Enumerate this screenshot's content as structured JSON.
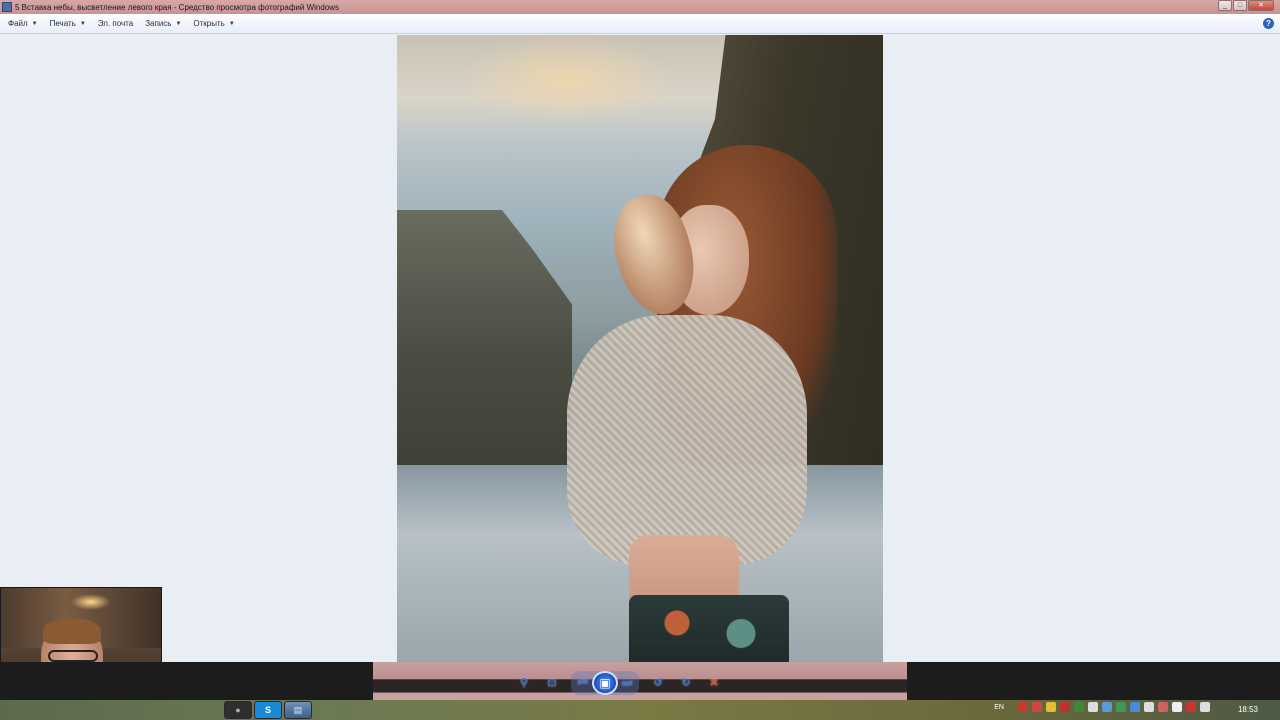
{
  "window": {
    "title": "5 Вставка небы, высветление левого края - Средство просмотра фотографий Windows",
    "controls": [
      "minimize",
      "maximize",
      "close"
    ]
  },
  "menu": {
    "items": [
      {
        "label": "Файл",
        "has_dropdown": true
      },
      {
        "label": "Печать",
        "has_dropdown": true
      },
      {
        "label": "Эл. почта",
        "has_dropdown": false
      },
      {
        "label": "Запись",
        "has_dropdown": true
      },
      {
        "label": "Открыть",
        "has_dropdown": true
      }
    ],
    "caret": "▼",
    "help": "?"
  },
  "viewer_controls": {
    "zoom": "⚲",
    "actual_size": "⊡",
    "previous": "⏮",
    "slideshow": "▣",
    "next": "⏭",
    "rotate_left": "↺",
    "rotate_right": "↻",
    "delete": "✕"
  },
  "taskbar": {
    "apps": [
      {
        "name": "recorder",
        "glyph": "●"
      },
      {
        "name": "skype",
        "glyph": "S"
      },
      {
        "name": "photo-viewer",
        "glyph": "▤"
      }
    ],
    "language": "EN",
    "clock": "18:53",
    "tray_icons": [
      {
        "name": "tray-icon-1",
        "color": "#c43b2f"
      },
      {
        "name": "tray-icon-2",
        "color": "#d44444"
      },
      {
        "name": "tray-icon-3",
        "color": "#e0c030"
      },
      {
        "name": "tray-icon-4",
        "color": "#c03030"
      },
      {
        "name": "tray-icon-5",
        "color": "#3a8a3a"
      },
      {
        "name": "tray-icon-6",
        "color": "#dddddd"
      },
      {
        "name": "tray-icon-7",
        "color": "#5a9ad6"
      },
      {
        "name": "tray-icon-8",
        "color": "#3a9a5a"
      },
      {
        "name": "tray-icon-9",
        "color": "#4a8ad6"
      },
      {
        "name": "tray-icon-10",
        "color": "#dddddd"
      },
      {
        "name": "tray-icon-11",
        "color": "#d46060"
      },
      {
        "name": "tray-icon-12",
        "color": "#eeeeee"
      },
      {
        "name": "tray-icon-13",
        "color": "#cc3333"
      },
      {
        "name": "tray-icon-14",
        "color": "#dddddd"
      }
    ]
  }
}
